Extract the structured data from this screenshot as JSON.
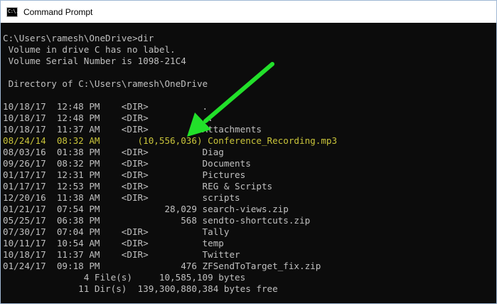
{
  "window": {
    "title": "Command Prompt",
    "icon_text": "C:\\."
  },
  "console": {
    "prompt": "C:\\Users\\ramesh\\OneDrive>dir",
    "volume_label": " Volume in drive C has no label.",
    "volume_serial": " Volume Serial Number is 1098-21C4",
    "directory_of": " Directory of C:\\Users\\ramesh\\OneDrive",
    "entries": [
      {
        "text": "10/18/17  12:48 PM    <DIR>          ."
      },
      {
        "text": "10/18/17  12:48 PM    <DIR>          .."
      },
      {
        "text": "10/18/17  11:37 AM    <DIR>          Attachments"
      },
      {
        "text": "08/24/14  08:32 AM       (10,556,036) Conference_Recording.mp3",
        "highlight": true
      },
      {
        "text": "08/03/16  01:38 PM    <DIR>          Diag"
      },
      {
        "text": "09/26/17  08:32 PM    <DIR>          Documents"
      },
      {
        "text": "01/17/17  12:31 PM    <DIR>          Pictures"
      },
      {
        "text": "01/17/17  12:53 PM    <DIR>          REG & Scripts"
      },
      {
        "text": "12/20/16  11:38 AM    <DIR>          scripts"
      },
      {
        "text": "01/21/17  07:54 PM            28,029 search-views.zip"
      },
      {
        "text": "05/25/17  06:38 PM               568 sendto-shortcuts.zip"
      },
      {
        "text": "07/30/17  07:04 PM    <DIR>          Tally"
      },
      {
        "text": "10/11/17  10:54 AM    <DIR>          temp"
      },
      {
        "text": "10/18/17  11:37 AM    <DIR>          Twitter"
      },
      {
        "text": "01/24/17  09:18 PM               476 ZFSendToTarget_fix.zip"
      }
    ],
    "summary_files": "               4 File(s)     10,585,109 bytes",
    "summary_dirs": "              11 Dir(s)  139,300,880,384 bytes free"
  },
  "colors": {
    "console_bg": "#0c0c0c",
    "console_text": "#c0c0c0",
    "highlight_text": "#c9c43a",
    "arrow": "#22e02a"
  },
  "annotation": {
    "icon": "green-arrow-icon"
  }
}
